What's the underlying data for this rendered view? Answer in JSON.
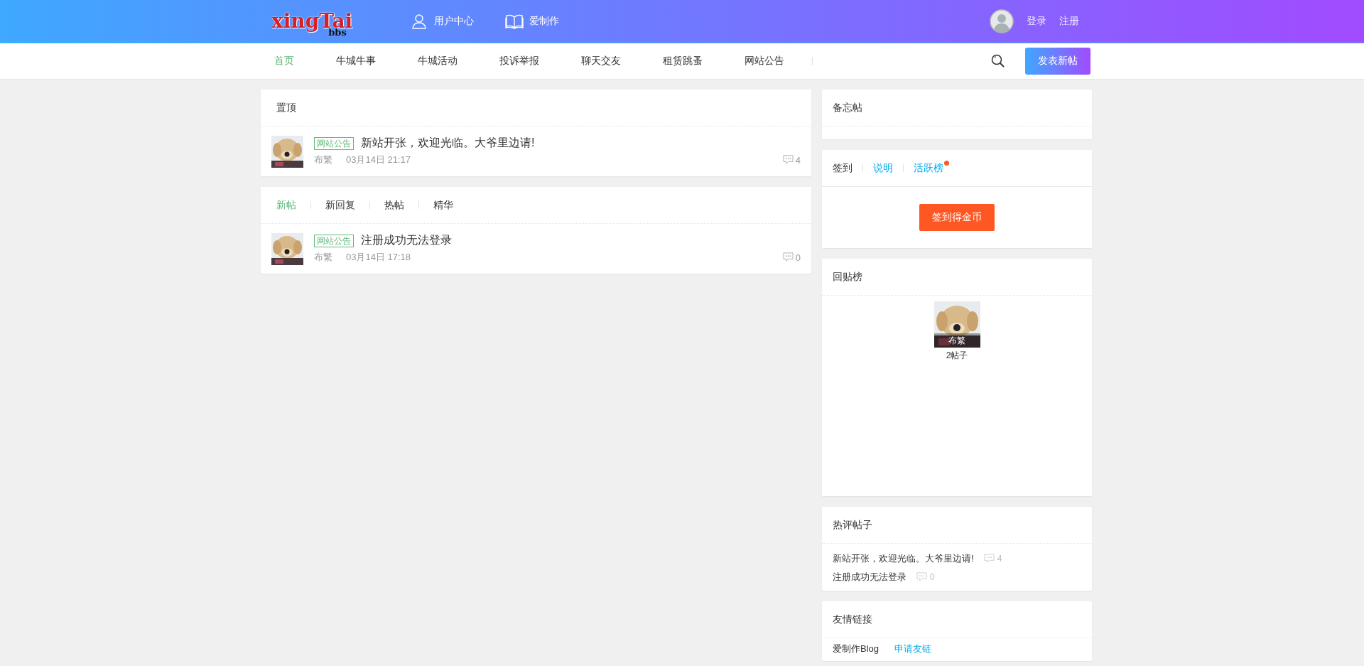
{
  "header": {
    "logo": {
      "text": "xingTai",
      "sub": "bbs"
    },
    "links": [
      {
        "kind": "user",
        "label": "用户中心"
      },
      {
        "kind": "book",
        "label": "爱制作"
      }
    ],
    "auth": [
      "登录",
      "注册"
    ]
  },
  "nav": {
    "items": [
      {
        "label": "首页",
        "selected": true
      },
      {
        "label": "牛城牛事",
        "selected": false
      },
      {
        "label": "牛城活动",
        "selected": false
      },
      {
        "label": "投诉举报",
        "selected": false
      },
      {
        "label": "聊天交友",
        "selected": false
      },
      {
        "label": "租赁跳蚤",
        "selected": false
      },
      {
        "label": "网站公告",
        "selected": false
      }
    ],
    "post_button": "发表新帖"
  },
  "pinned": {
    "title": "置顶",
    "posts": [
      {
        "tag": "网站公告",
        "title": "新站开张，欢迎光临。大爷里边请!",
        "author": "布繁",
        "time": "03月14日 21:17",
        "comments": "4"
      }
    ]
  },
  "feed": {
    "tabs": [
      {
        "label": "新帖",
        "selected": true
      },
      {
        "label": "新回复",
        "selected": false
      },
      {
        "label": "热帖",
        "selected": false
      },
      {
        "label": "精华",
        "selected": false
      }
    ],
    "posts": [
      {
        "tag": "网站公告",
        "title": "注册成功无法登录",
        "author": "布繁",
        "time": "03月14日 17:18",
        "comments": "0"
      }
    ]
  },
  "memo": {
    "title": "备忘帖"
  },
  "signin": {
    "tabs": [
      {
        "label": "签到",
        "selected": true,
        "dot": false
      },
      {
        "label": "说明",
        "selected": false,
        "dot": false
      },
      {
        "label": "活跃榜",
        "selected": false,
        "dot": true
      }
    ],
    "button": "签到得金币"
  },
  "reply_rank": {
    "title": "回贴榜",
    "users": [
      {
        "name": "布繁",
        "count": "2帖子"
      }
    ]
  },
  "hot": {
    "title": "热评帖子",
    "posts": [
      {
        "title": "新站开张，欢迎光临。大爷里边请!",
        "comments": "4"
      },
      {
        "title": "注册成功无法登录",
        "comments": "0"
      }
    ]
  },
  "links": {
    "title": "友情链接",
    "items": [
      {
        "label": "爱制作Blog",
        "kind": "site"
      },
      {
        "label": "申请友链",
        "kind": "apply"
      }
    ]
  }
}
